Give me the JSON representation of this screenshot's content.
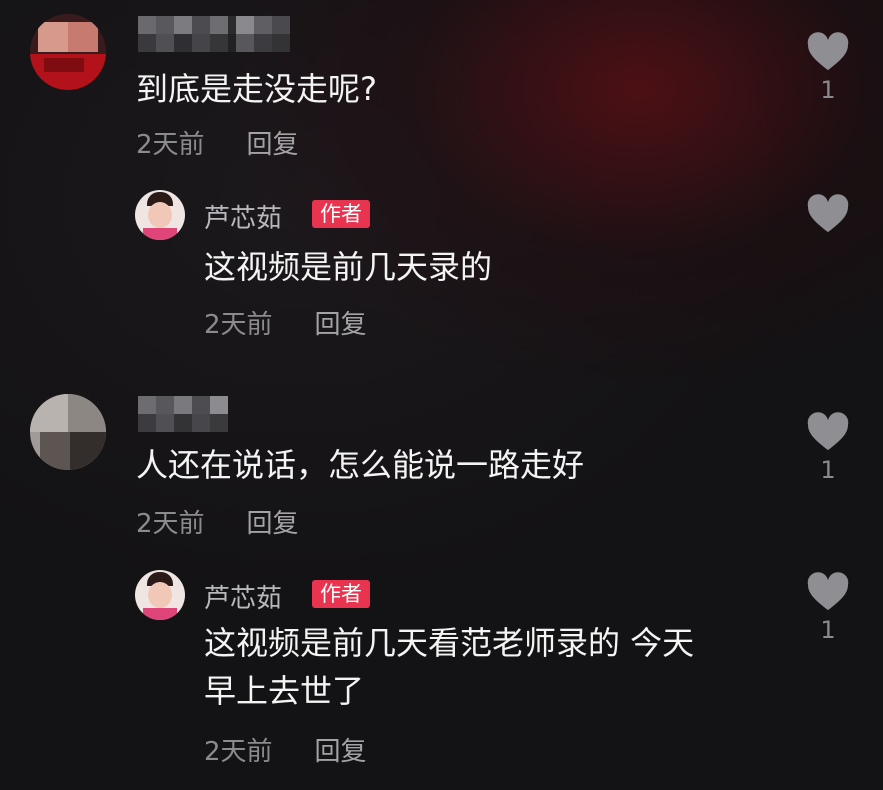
{
  "comments": [
    {
      "text": "到底是走没走呢?",
      "time": "2天前",
      "reply_label": "回复",
      "likes": "1",
      "reply": {
        "author": "芦芯茹",
        "badge": "作者",
        "text": "这视频是前几天录的",
        "time": "2天前",
        "reply_label": "回复",
        "likes": ""
      }
    },
    {
      "text": "人还在说话，怎么能说一路走好",
      "time": "2天前",
      "reply_label": "回复",
      "likes": "1",
      "reply": {
        "author": "芦芯茹",
        "badge": "作者",
        "text_line1": "这视频是前几天看范老师录的 今天",
        "text_line2": "早上去世了",
        "time": "2天前",
        "reply_label": "回复",
        "likes": "1"
      }
    }
  ],
  "colors": {
    "badge": "#e8344f",
    "meta": "#8b8b8f",
    "text": "#f4f4f4",
    "heart": "#8f8f93"
  }
}
